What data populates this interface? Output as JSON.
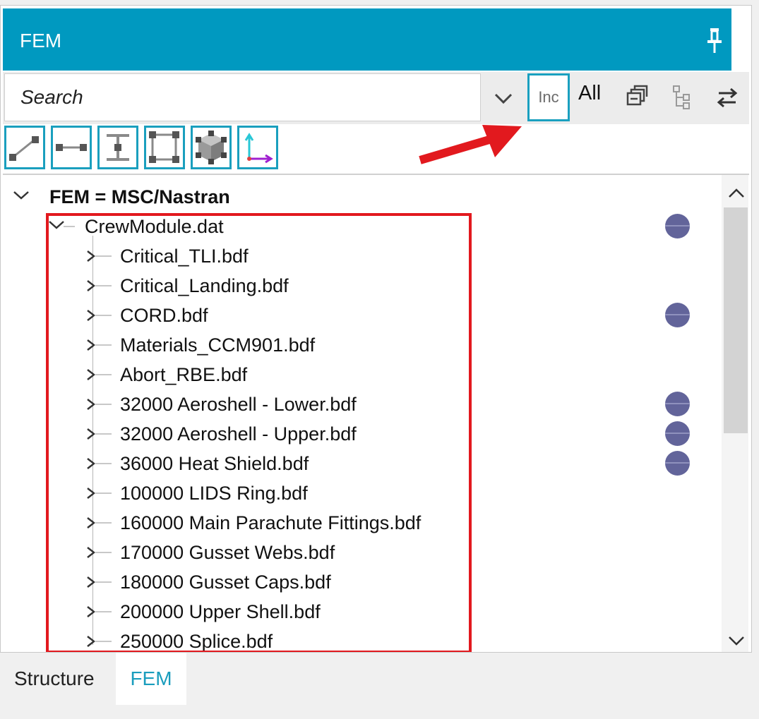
{
  "panel": {
    "title": "FEM"
  },
  "toolbar": {
    "search_placeholder": "Search",
    "inc_label": "Inc",
    "all_label": "All"
  },
  "tree": {
    "root": "FEM = MSC/Nastran",
    "module": "CrewModule.dat",
    "items": [
      "Critical_TLI.bdf",
      "Critical_Landing.bdf",
      "CORD.bdf",
      "Materials_CCM901.bdf",
      "Abort_RBE.bdf",
      "32000 Aeroshell - Lower.bdf",
      "32000 Aeroshell - Upper.bdf",
      "36000 Heat Shield.bdf",
      "100000 LIDS Ring.bdf",
      "160000 Main Parachute Fittings.bdf",
      "170000 Gusset Webs.bdf",
      "180000 Gusset Caps.bdf",
      "200000 Upper Shell.bdf",
      "250000 Splice.bdf"
    ]
  },
  "tabs": {
    "structure": "Structure",
    "fem": "FEM"
  },
  "colors": {
    "accent": "#0099c0",
    "highlight": "#e2191e",
    "dot": "#62649a"
  }
}
